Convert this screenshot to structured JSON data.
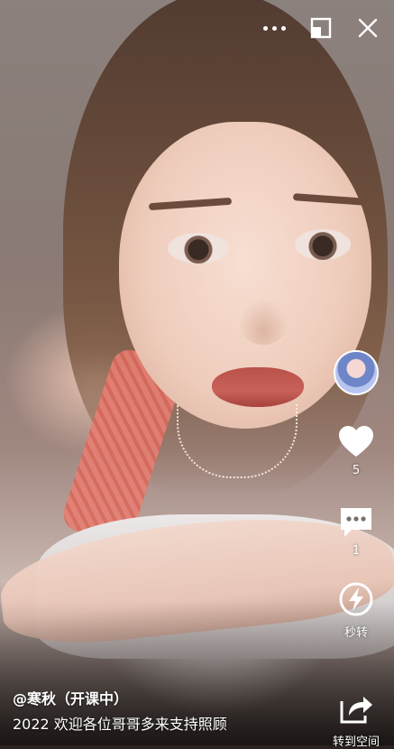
{
  "topbar": {
    "more_icon": "more-dots-icon",
    "pip_icon": "picture-in-picture-icon",
    "close_icon": "close-icon"
  },
  "rail": {
    "avatar_icon": "user-avatar",
    "like": {
      "icon": "heart-icon",
      "count": "5"
    },
    "comment": {
      "icon": "comment-icon",
      "count": "1"
    },
    "flash_share": {
      "icon": "lightning-icon",
      "label": "秒转"
    },
    "share": {
      "icon": "share-arrow-icon",
      "label": "转到空间"
    }
  },
  "video": {
    "author": "@寒秋（开课中）",
    "caption": "2022 欢迎各位哥哥多来支持照顾"
  }
}
